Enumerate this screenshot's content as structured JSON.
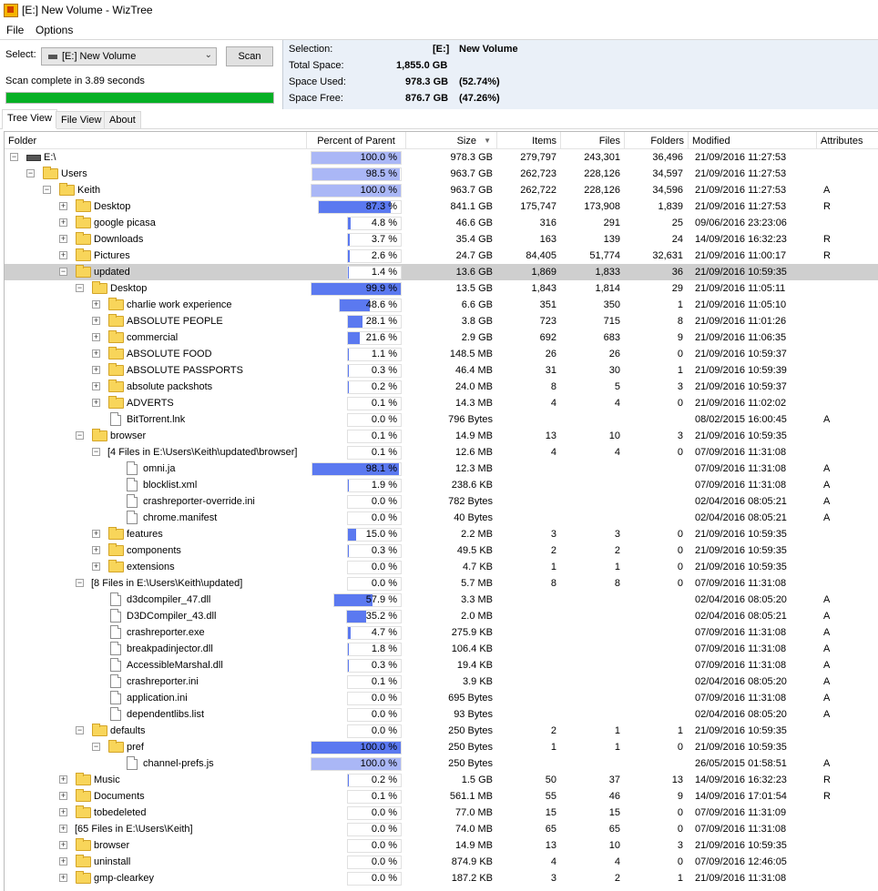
{
  "window": {
    "title": "[E:] New Volume  - WizTree"
  },
  "menu": {
    "file": "File",
    "options": "Options"
  },
  "toolbar": {
    "select_label": "Select:",
    "drive_value": "[E:] New Volume",
    "scan_button": "Scan",
    "status": "Scan complete in 3.89 seconds",
    "progress_percent": 100
  },
  "summary": {
    "selection_label": "Selection:",
    "selection_drive": "[E:]",
    "selection_name": "New Volume",
    "total_label": "Total Space:",
    "total_value": "1,855.0 GB",
    "used_label": "Space Used:",
    "used_value": "978.3 GB",
    "used_pct": "(52.74%)",
    "free_label": "Space Free:",
    "free_value": "876.7 GB",
    "free_pct": "(47.26%)"
  },
  "tabs": [
    "Tree View",
    "File View",
    "About"
  ],
  "columns": [
    "Folder",
    "Percent of Parent",
    "Size",
    "Items",
    "Files",
    "Folders",
    "Modified",
    "Attributes"
  ],
  "colors": {
    "accent_bar": "#5b79f0",
    "light_bar": "#aab7f6",
    "progress": "#06b025"
  },
  "rows": [
    {
      "depth": 0,
      "icon": "drive",
      "exp": "-",
      "name": "E:\\",
      "pct": "100.0 %",
      "fill": 100,
      "size": "978.3 GB",
      "items": "279,797",
      "files": "243,301",
      "folders": "36,496",
      "modified": "21/09/2016 11:27:53",
      "attr": ""
    },
    {
      "depth": 1,
      "icon": "folder",
      "exp": "-",
      "name": "Users",
      "pct": "98.5 %",
      "fill": 98.5,
      "size": "963.7 GB",
      "items": "262,723",
      "files": "228,126",
      "folders": "34,597",
      "modified": "21/09/2016 11:27:53",
      "attr": ""
    },
    {
      "depth": 2,
      "icon": "folder",
      "exp": "-",
      "name": "Keith",
      "pct": "100.0 %",
      "fill": 100,
      "size": "963.7 GB",
      "items": "262,722",
      "files": "228,126",
      "folders": "34,596",
      "modified": "21/09/2016 11:27:53",
      "attr": "A"
    },
    {
      "depth": 3,
      "icon": "folder",
      "exp": "+",
      "name": "Desktop",
      "pct": "87.3 %",
      "fill": 87.3,
      "size": "841.1 GB",
      "items": "175,747",
      "files": "173,908",
      "folders": "1,839",
      "modified": "21/09/2016 11:27:53",
      "attr": "R"
    },
    {
      "depth": 3,
      "icon": "folder",
      "exp": "+",
      "name": "google picasa",
      "pct": "4.8 %",
      "fill": 4.8,
      "size": "46.6 GB",
      "items": "316",
      "files": "291",
      "folders": "25",
      "modified": "09/06/2016 23:23:06",
      "attr": ""
    },
    {
      "depth": 3,
      "icon": "folder",
      "exp": "+",
      "name": "Downloads",
      "pct": "3.7 %",
      "fill": 3.7,
      "size": "35.4 GB",
      "items": "163",
      "files": "139",
      "folders": "24",
      "modified": "14/09/2016 16:32:23",
      "attr": "R"
    },
    {
      "depth": 3,
      "icon": "folder",
      "exp": "+",
      "name": "Pictures",
      "pct": "2.6 %",
      "fill": 2.6,
      "size": "24.7 GB",
      "items": "84,405",
      "files": "51,774",
      "folders": "32,631",
      "modified": "21/09/2016 11:00:17",
      "attr": "R"
    },
    {
      "depth": 3,
      "icon": "folder",
      "exp": "-",
      "name": "updated",
      "pct": "1.4 %",
      "fill": 1.4,
      "size": "13.6 GB",
      "items": "1,869",
      "files": "1,833",
      "folders": "36",
      "modified": "21/09/2016 10:59:35",
      "attr": "",
      "sel": true
    },
    {
      "depth": 4,
      "icon": "folder",
      "exp": "-",
      "name": "Desktop",
      "pct": "99.9 %",
      "fill": 99.9,
      "size": "13.5 GB",
      "items": "1,843",
      "files": "1,814",
      "folders": "29",
      "modified": "21/09/2016 11:05:11",
      "attr": ""
    },
    {
      "depth": 5,
      "icon": "folder",
      "exp": "+",
      "name": "charlie work experience",
      "pct": "48.6 %",
      "fill": 48.6,
      "size": "6.6 GB",
      "items": "351",
      "files": "350",
      "folders": "1",
      "modified": "21/09/2016 11:05:10",
      "attr": ""
    },
    {
      "depth": 5,
      "icon": "folder",
      "exp": "+",
      "name": "ABSOLUTE PEOPLE",
      "pct": "28.1 %",
      "fill": 28.1,
      "size": "3.8 GB",
      "items": "723",
      "files": "715",
      "folders": "8",
      "modified": "21/09/2016 11:01:26",
      "attr": ""
    },
    {
      "depth": 5,
      "icon": "folder",
      "exp": "+",
      "name": "commercial",
      "pct": "21.6 %",
      "fill": 21.6,
      "size": "2.9 GB",
      "items": "692",
      "files": "683",
      "folders": "9",
      "modified": "21/09/2016 11:06:35",
      "attr": ""
    },
    {
      "depth": 5,
      "icon": "folder",
      "exp": "+",
      "name": "ABSOLUTE FOOD",
      "pct": "1.1 %",
      "fill": 1.1,
      "size": "148.5 MB",
      "items": "26",
      "files": "26",
      "folders": "0",
      "modified": "21/09/2016 10:59:37",
      "attr": ""
    },
    {
      "depth": 5,
      "icon": "folder",
      "exp": "+",
      "name": "ABSOLUTE PASSPORTS",
      "pct": "0.3 %",
      "fill": 0.3,
      "size": "46.4 MB",
      "items": "31",
      "files": "30",
      "folders": "1",
      "modified": "21/09/2016 10:59:39",
      "attr": ""
    },
    {
      "depth": 5,
      "icon": "folder",
      "exp": "+",
      "name": "absolute packshots",
      "pct": "0.2 %",
      "fill": 0.2,
      "size": "24.0 MB",
      "items": "8",
      "files": "5",
      "folders": "3",
      "modified": "21/09/2016 10:59:37",
      "attr": ""
    },
    {
      "depth": 5,
      "icon": "folder",
      "exp": "+",
      "name": "ADVERTS",
      "pct": "0.1 %",
      "fill": 0.1,
      "size": "14.3 MB",
      "items": "4",
      "files": "4",
      "folders": "0",
      "modified": "21/09/2016 11:02:02",
      "attr": ""
    },
    {
      "depth": 5,
      "icon": "file",
      "exp": "",
      "name": "BitTorrent.lnk",
      "pct": "0.0 %",
      "fill": 0,
      "size": "796 Bytes",
      "items": "",
      "files": "",
      "folders": "",
      "modified": "08/02/2015 16:00:45",
      "attr": "A"
    },
    {
      "depth": 4,
      "icon": "folder",
      "exp": "-",
      "name": "browser",
      "pct": "0.1 %",
      "fill": 0.1,
      "size": "14.9 MB",
      "items": "13",
      "files": "10",
      "folders": "3",
      "modified": "21/09/2016 10:59:35",
      "attr": ""
    },
    {
      "depth": 5,
      "icon": "none",
      "exp": "-",
      "name": "[4 Files in E:\\Users\\Keith\\updated\\browser]",
      "pct": "0.1 %",
      "fill": 0.1,
      "size": "12.6 MB",
      "items": "4",
      "files": "4",
      "folders": "0",
      "modified": "07/09/2016 11:31:08",
      "attr": ""
    },
    {
      "depth": 6,
      "icon": "file",
      "exp": "",
      "name": "omni.ja",
      "pct": "98.1 %",
      "fill": 98.1,
      "size": "12.3 MB",
      "items": "",
      "files": "",
      "folders": "",
      "modified": "07/09/2016 11:31:08",
      "attr": "A"
    },
    {
      "depth": 6,
      "icon": "file",
      "exp": "",
      "name": "blocklist.xml",
      "pct": "1.9 %",
      "fill": 1.9,
      "size": "238.6 KB",
      "items": "",
      "files": "",
      "folders": "",
      "modified": "07/09/2016 11:31:08",
      "attr": "A"
    },
    {
      "depth": 6,
      "icon": "file",
      "exp": "",
      "name": "crashreporter-override.ini",
      "pct": "0.0 %",
      "fill": 0,
      "size": "782 Bytes",
      "items": "",
      "files": "",
      "folders": "",
      "modified": "02/04/2016 08:05:21",
      "attr": "A"
    },
    {
      "depth": 6,
      "icon": "file",
      "exp": "",
      "name": "chrome.manifest",
      "pct": "0.0 %",
      "fill": 0,
      "size": "40 Bytes",
      "items": "",
      "files": "",
      "folders": "",
      "modified": "02/04/2016 08:05:21",
      "attr": "A"
    },
    {
      "depth": 5,
      "icon": "folder",
      "exp": "+",
      "name": "features",
      "pct": "15.0 %",
      "fill": 15.0,
      "size": "2.2 MB",
      "items": "3",
      "files": "3",
      "folders": "0",
      "modified": "21/09/2016 10:59:35",
      "attr": ""
    },
    {
      "depth": 5,
      "icon": "folder",
      "exp": "+",
      "name": "components",
      "pct": "0.3 %",
      "fill": 0.3,
      "size": "49.5 KB",
      "items": "2",
      "files": "2",
      "folders": "0",
      "modified": "21/09/2016 10:59:35",
      "attr": ""
    },
    {
      "depth": 5,
      "icon": "folder",
      "exp": "+",
      "name": "extensions",
      "pct": "0.0 %",
      "fill": 0,
      "size": "4.7 KB",
      "items": "1",
      "files": "1",
      "folders": "0",
      "modified": "21/09/2016 10:59:35",
      "attr": ""
    },
    {
      "depth": 4,
      "icon": "none",
      "exp": "-",
      "name": "[8 Files in E:\\Users\\Keith\\updated]",
      "pct": "0.0 %",
      "fill": 0,
      "size": "5.7 MB",
      "items": "8",
      "files": "8",
      "folders": "0",
      "modified": "07/09/2016 11:31:08",
      "attr": ""
    },
    {
      "depth": 5,
      "icon": "file",
      "exp": "",
      "name": "d3dcompiler_47.dll",
      "pct": "57.9 %",
      "fill": 57.9,
      "size": "3.3 MB",
      "items": "",
      "files": "",
      "folders": "",
      "modified": "02/04/2016 08:05:20",
      "attr": "A"
    },
    {
      "depth": 5,
      "icon": "file",
      "exp": "",
      "name": "D3DCompiler_43.dll",
      "pct": "35.2 %",
      "fill": 35.2,
      "size": "2.0 MB",
      "items": "",
      "files": "",
      "folders": "",
      "modified": "02/04/2016 08:05:21",
      "attr": "A"
    },
    {
      "depth": 5,
      "icon": "file",
      "exp": "",
      "name": "crashreporter.exe",
      "pct": "4.7 %",
      "fill": 4.7,
      "size": "275.9 KB",
      "items": "",
      "files": "",
      "folders": "",
      "modified": "07/09/2016 11:31:08",
      "attr": "A"
    },
    {
      "depth": 5,
      "icon": "file",
      "exp": "",
      "name": "breakpadinjector.dll",
      "pct": "1.8 %",
      "fill": 1.8,
      "size": "106.4 KB",
      "items": "",
      "files": "",
      "folders": "",
      "modified": "07/09/2016 11:31:08",
      "attr": "A"
    },
    {
      "depth": 5,
      "icon": "file",
      "exp": "",
      "name": "AccessibleMarshal.dll",
      "pct": "0.3 %",
      "fill": 0.3,
      "size": "19.4 KB",
      "items": "",
      "files": "",
      "folders": "",
      "modified": "07/09/2016 11:31:08",
      "attr": "A"
    },
    {
      "depth": 5,
      "icon": "file",
      "exp": "",
      "name": "crashreporter.ini",
      "pct": "0.1 %",
      "fill": 0.1,
      "size": "3.9 KB",
      "items": "",
      "files": "",
      "folders": "",
      "modified": "02/04/2016 08:05:20",
      "attr": "A"
    },
    {
      "depth": 5,
      "icon": "file",
      "exp": "",
      "name": "application.ini",
      "pct": "0.0 %",
      "fill": 0,
      "size": "695 Bytes",
      "items": "",
      "files": "",
      "folders": "",
      "modified": "07/09/2016 11:31:08",
      "attr": "A"
    },
    {
      "depth": 5,
      "icon": "file",
      "exp": "",
      "name": "dependentlibs.list",
      "pct": "0.0 %",
      "fill": 0,
      "size": "93 Bytes",
      "items": "",
      "files": "",
      "folders": "",
      "modified": "02/04/2016 08:05:20",
      "attr": "A"
    },
    {
      "depth": 4,
      "icon": "folder",
      "exp": "-",
      "name": "defaults",
      "pct": "0.0 %",
      "fill": 0,
      "size": "250 Bytes",
      "items": "2",
      "files": "1",
      "folders": "1",
      "modified": "21/09/2016 10:59:35",
      "attr": ""
    },
    {
      "depth": 5,
      "icon": "folder",
      "exp": "-",
      "name": "pref",
      "pct": "100.0 %",
      "fill": 100,
      "size": "250 Bytes",
      "items": "1",
      "files": "1",
      "folders": "0",
      "modified": "21/09/2016 10:59:35",
      "attr": ""
    },
    {
      "depth": 6,
      "icon": "file",
      "exp": "",
      "name": "channel-prefs.js",
      "pct": "100.0 %",
      "fill": 100,
      "size": "250 Bytes",
      "items": "",
      "files": "",
      "folders": "",
      "modified": "26/05/2015 01:58:51",
      "attr": "A",
      "light": true
    },
    {
      "depth": 3,
      "icon": "folder",
      "exp": "+",
      "name": "Music",
      "pct": "0.2 %",
      "fill": 0.2,
      "size": "1.5 GB",
      "items": "50",
      "files": "37",
      "folders": "13",
      "modified": "14/09/2016 16:32:23",
      "attr": "R"
    },
    {
      "depth": 3,
      "icon": "folder",
      "exp": "+",
      "name": "Documents",
      "pct": "0.1 %",
      "fill": 0.1,
      "size": "561.1 MB",
      "items": "55",
      "files": "46",
      "folders": "9",
      "modified": "14/09/2016 17:01:54",
      "attr": "R"
    },
    {
      "depth": 3,
      "icon": "folder",
      "exp": "+",
      "name": "tobedeleted",
      "pct": "0.0 %",
      "fill": 0,
      "size": "77.0 MB",
      "items": "15",
      "files": "15",
      "folders": "0",
      "modified": "07/09/2016 11:31:09",
      "attr": ""
    },
    {
      "depth": 3,
      "icon": "none",
      "exp": "+",
      "name": "[65 Files in E:\\Users\\Keith]",
      "pct": "0.0 %",
      "fill": 0,
      "size": "74.0 MB",
      "items": "65",
      "files": "65",
      "folders": "0",
      "modified": "07/09/2016 11:31:08",
      "attr": ""
    },
    {
      "depth": 3,
      "icon": "folder",
      "exp": "+",
      "name": "browser",
      "pct": "0.0 %",
      "fill": 0,
      "size": "14.9 MB",
      "items": "13",
      "files": "10",
      "folders": "3",
      "modified": "21/09/2016 10:59:35",
      "attr": ""
    },
    {
      "depth": 3,
      "icon": "folder",
      "exp": "+",
      "name": "uninstall",
      "pct": "0.0 %",
      "fill": 0,
      "size": "874.9 KB",
      "items": "4",
      "files": "4",
      "folders": "0",
      "modified": "07/09/2016 12:46:05",
      "attr": ""
    },
    {
      "depth": 3,
      "icon": "folder",
      "exp": "+",
      "name": "gmp-clearkey",
      "pct": "0.0 %",
      "fill": 0,
      "size": "187.2 KB",
      "items": "3",
      "files": "2",
      "folders": "1",
      "modified": "21/09/2016 11:31:08",
      "attr": ""
    }
  ]
}
